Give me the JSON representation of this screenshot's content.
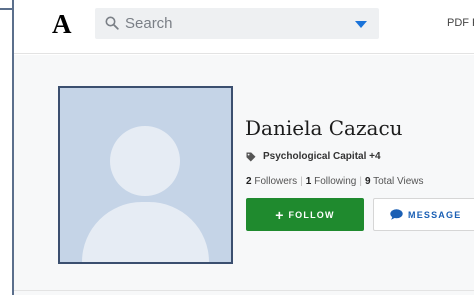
{
  "header": {
    "logo": "A",
    "search": {
      "placeholder": "Search"
    },
    "pdf_link": "PDF P"
  },
  "profile": {
    "name": "Daniela Cazacu",
    "research_interest": "Psychological Capital +4",
    "stats": {
      "followers_count": "2",
      "followers_label": "Followers",
      "following_count": "1",
      "following_label": "Following",
      "views_count": "9",
      "views_label": "Total Views"
    },
    "follow_label": "FOLLOW",
    "message_label": "MESSAGE"
  },
  "colors": {
    "follow_green": "#1f8a2e",
    "message_blue": "#1a5fb4",
    "avatar_bg": "#c5d4e7"
  },
  "icons": [
    "search-icon",
    "dropdown-caret-icon",
    "tag-icon",
    "plus-icon",
    "chat-bubble-icon",
    "default-avatar-icon"
  ]
}
